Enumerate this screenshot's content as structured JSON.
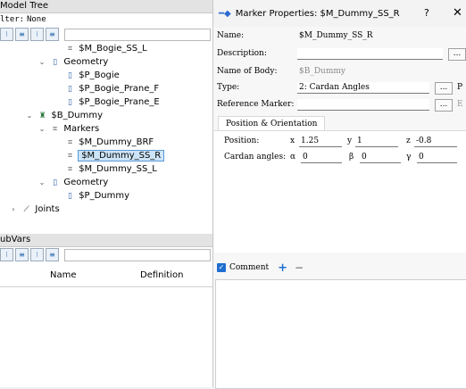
{
  "model_tree": {
    "title": "Model Tree",
    "filter_label": "lter:",
    "filter_value": "None",
    "nodes": [
      {
        "label": "$M_Bogie_SS_L",
        "icon": "marker-icon"
      },
      {
        "label": "Geometry",
        "icon": "geometry-icon",
        "arrow": "v"
      },
      {
        "label": "$P_Bogie",
        "icon": "geometry-icon"
      },
      {
        "label": "$P_Bogie_Prane_F",
        "icon": "geometry-icon"
      },
      {
        "label": "$P_Bogie_Prane_E",
        "icon": "geometry-icon"
      },
      {
        "label": "$B_Dummy",
        "icon": "body-icon",
        "arrow": "v"
      },
      {
        "label": "Markers",
        "icon": "marker-icon",
        "arrow": "v"
      },
      {
        "label": "$M_Dummy_BRF",
        "icon": "marker-icon"
      },
      {
        "label": "$M_Dummy_SS_R",
        "icon": "marker-icon",
        "selected": true
      },
      {
        "label": "$M_Dummy_SS_L",
        "icon": "marker-icon"
      },
      {
        "label": "Geometry",
        "icon": "geometry-icon",
        "arrow": "v"
      },
      {
        "label": "$P_Dummy",
        "icon": "geometry-icon"
      },
      {
        "label": "Joints",
        "icon": "joint-icon",
        "arrow": ">"
      }
    ]
  },
  "subvars": {
    "title": "ubVars",
    "col_name": "Name",
    "col_definition": "Definition"
  },
  "dialog": {
    "title": "Marker Properties: $M_Dummy_SS_R",
    "help": "?",
    "close": "✕",
    "name_label": "Name:",
    "name_value": "$M_Dummy_SS_R",
    "description_label": "Description:",
    "description_value": "",
    "body_label": "Name of Body:",
    "body_value": "$B_Dummy",
    "type_label": "Type:",
    "type_value": "2: Cardan Angles",
    "type_trailing": "P",
    "ref_label": "Reference Marker:",
    "ref_value": "",
    "ref_trailing": "E",
    "ellipsis": "...",
    "tab_label": "Position & Orientation",
    "position_label": "Position:",
    "x_label": "x",
    "x_value": "1.25",
    "y_label": "y",
    "y_value": "1",
    "z_label": "z",
    "z_value": "-0.8",
    "cardan_label": "Cardan angles:",
    "alpha_label": "α",
    "alpha_value": "0",
    "beta_label": "β",
    "beta_value": "0",
    "gamma_label": "γ",
    "gamma_value": "0",
    "comment_label": "Comment",
    "add_symbol": "+",
    "remove_symbol": "−"
  }
}
